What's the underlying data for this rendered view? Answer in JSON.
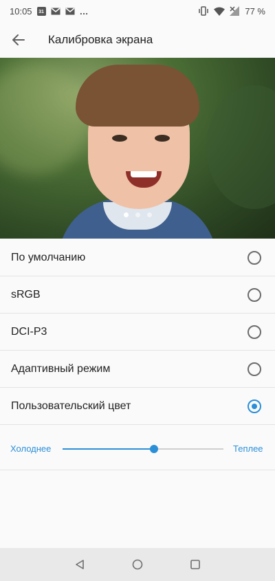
{
  "status_bar": {
    "time": "10:05",
    "calendar_day": "31",
    "more": "…",
    "battery": "77 %"
  },
  "app_bar": {
    "title": "Калибровка экрана"
  },
  "carousel": {
    "pages": 3,
    "active_page": 1
  },
  "options": [
    {
      "label": "По умолчанию",
      "selected": false
    },
    {
      "label": "sRGB",
      "selected": false
    },
    {
      "label": "DCI-P3",
      "selected": false
    },
    {
      "label": "Адаптивный режим",
      "selected": false
    },
    {
      "label": "Пользовательский цвет",
      "selected": true
    }
  ],
  "slider": {
    "left_label": "Холоднее",
    "right_label": "Теплее",
    "value": 0.57
  },
  "colors": {
    "accent": "#2b8fd8",
    "text": "#212121",
    "background": "#fafafa",
    "nav_bar": "#e9e9e9"
  },
  "icons": {
    "back": "arrow-left-icon",
    "nav_back": "triangle-back-icon",
    "nav_home": "circle-home-icon",
    "nav_recents": "square-recents-icon"
  }
}
